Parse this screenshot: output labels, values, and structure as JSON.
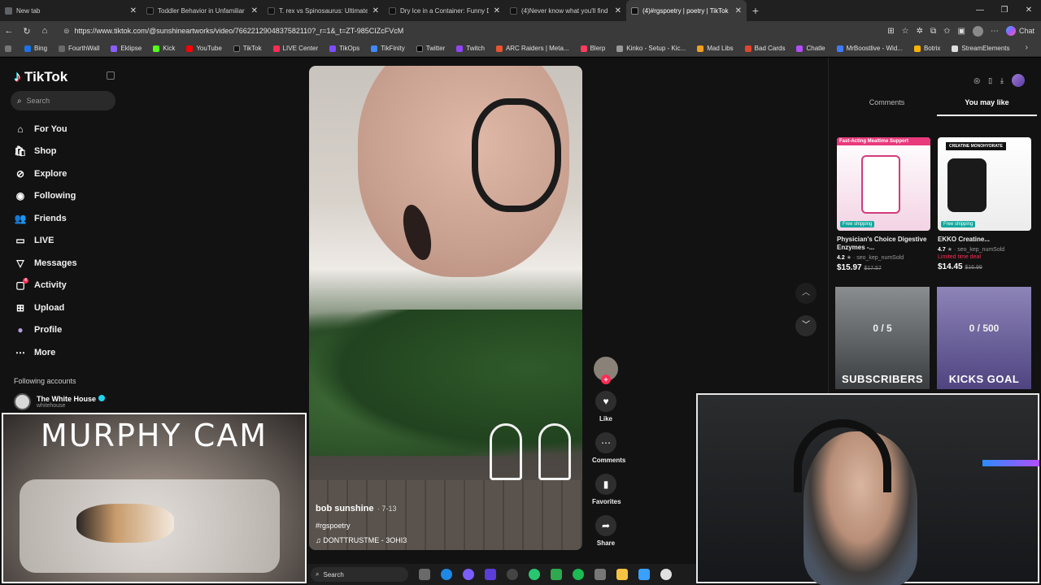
{
  "browser": {
    "tabs": [
      {
        "title": "New tab",
        "color": "#5f6368"
      },
      {
        "title": "Toddler Behavior in Unfamiliar Pla",
        "color": "#111111"
      },
      {
        "title": "T. rex vs Spinosaurus: Ultimate Din",
        "color": "#111111"
      },
      {
        "title": "Dry Ice in a Container: Funny Dry Ic",
        "color": "#111111"
      },
      {
        "title": "(4)Never know what you'll find in t",
        "color": "#111111"
      },
      {
        "title": "(4)#rgspoetry | poetry | TikTok",
        "color": "#111111"
      }
    ],
    "url": "https://www.tiktok.com/@sunshineartworks/video/7662212904837582110?_r=1&_t=ZT-985CIZcFVcM",
    "chat_label": "Chat",
    "bookmarks": [
      {
        "label": "Bing",
        "color": "#1a73e8"
      },
      {
        "label": "FourthWall",
        "color": "#6b6b6b"
      },
      {
        "label": "Eklipse",
        "color": "#8c5cff"
      },
      {
        "label": "Kick",
        "color": "#53fc18"
      },
      {
        "label": "YouTube",
        "color": "#ff0000"
      },
      {
        "label": "TikTok",
        "color": "#111111"
      },
      {
        "label": "LIVE Center",
        "color": "#fe2c55"
      },
      {
        "label": "TikOps",
        "color": "#7c4dff"
      },
      {
        "label": "TikFinity",
        "color": "#3f88ff"
      },
      {
        "label": "Twitter",
        "color": "#000000"
      },
      {
        "label": "Twitch",
        "color": "#9146ff"
      },
      {
        "label": "ARC Raiders | Meta...",
        "color": "#e8542e"
      },
      {
        "label": "Blerp",
        "color": "#ff3b5c"
      },
      {
        "label": "Kinko - Setup - Kic...",
        "color": "#444444"
      },
      {
        "label": "Mad Libs",
        "color": "#f0a020"
      },
      {
        "label": "Bad Cards",
        "color": "#e0462d"
      },
      {
        "label": "Chatle",
        "color": "#b34dff"
      },
      {
        "label": "MrBoostlive - Wid...",
        "color": "#3f7bff"
      },
      {
        "label": "Botrix",
        "color": "#ffb300"
      },
      {
        "label": "StreamElements",
        "color": "#1d1d1d"
      }
    ]
  },
  "tiktok": {
    "brand": "TikTok",
    "search_placeholder": "Search",
    "nav": [
      {
        "label": "For You",
        "icon": "home-icon"
      },
      {
        "label": "Shop",
        "icon": "shop-icon"
      },
      {
        "label": "Explore",
        "icon": "compass-icon"
      },
      {
        "label": "Following",
        "icon": "following-icon"
      },
      {
        "label": "Friends",
        "icon": "friends-icon"
      },
      {
        "label": "LIVE",
        "icon": "live-icon"
      },
      {
        "label": "Messages",
        "icon": "messages-icon"
      },
      {
        "label": "Activity",
        "icon": "activity-icon",
        "badge": "4"
      },
      {
        "label": "Upload",
        "icon": "upload-icon"
      },
      {
        "label": "Profile",
        "icon": "profile-icon"
      },
      {
        "label": "More",
        "icon": "more-icon"
      }
    ],
    "following_header": "Following accounts",
    "account": {
      "name": "The White House",
      "handle": "whitehouse"
    },
    "video": {
      "author": "bob sunshine",
      "date": "· 7-13",
      "hashtag": "#rgspoetry",
      "music": "DONTTRUSTME - 3OHI3"
    },
    "actions": [
      {
        "label": "Like",
        "icon": "heart-icon"
      },
      {
        "label": "Comments",
        "icon": "comment-icon"
      },
      {
        "label": "Favorites",
        "icon": "bookmark-icon"
      },
      {
        "label": "Share",
        "icon": "share-icon"
      }
    ],
    "right_tabs": [
      "Comments",
      "You may like"
    ],
    "products": [
      {
        "header": "Fast-Acting Mealtime Support",
        "name": "Physician's Choice Digestive Enzymes -...",
        "rating": "4.2",
        "sold": "seo_kep_numSold",
        "price": "$15.97",
        "old_price": "$17.57",
        "badge": "Free shipping",
        "promo": ""
      },
      {
        "header": "CREATINE MONOHYDRATE",
        "name": "EKKO Creatine...",
        "rating": "4.7",
        "sold": "seo_kep_numSold",
        "price": "$14.45",
        "old_price": "$16.99",
        "badge": "Free shipping",
        "promo": "Limited time deal"
      }
    ]
  },
  "overlays": {
    "subs": {
      "count": "0 / 5",
      "label": "SUBSCRIBERS"
    },
    "kicks": {
      "count": "0 / 500",
      "label": "KICKS GOAL"
    },
    "murphy_title": "MURPHY CAM"
  },
  "taskbar": {
    "search_label": "Search"
  }
}
